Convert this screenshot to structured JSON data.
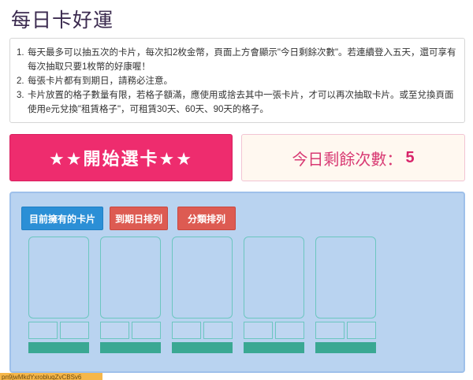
{
  "page": {
    "title": "每日卡好運"
  },
  "rules": [
    {
      "num": "1.",
      "text": "每天最多可以抽五次的卡片，每次扣2枚金幣，頁面上方會顯示\"今日剩餘次數\"。若連續登入五天，還可享有每次抽取只要1枚幣的好康喔！"
    },
    {
      "num": "2.",
      "text": "每張卡片都有到期日，請務必注意。"
    },
    {
      "num": "3.",
      "text": "卡片放置的格子數量有限，若格子額滿，應使用或捨去其中一張卡片，才可以再次抽取卡片。或至兌換頁面使用e元兌換\"租賃格子\"，可租賃30天、60天、90天的格子。"
    }
  ],
  "start_button": {
    "label": "★★開始選卡★★"
  },
  "remaining": {
    "label": "今日剩餘次數：",
    "count": "5"
  },
  "tabs": {
    "owned": "目前擁有的卡片",
    "expire": "到期日排列",
    "category": "分類排列"
  },
  "card_slot_count": 5,
  "footer": {
    "text": "pn9jwMkdYxrobluqZvCBSv6"
  }
}
